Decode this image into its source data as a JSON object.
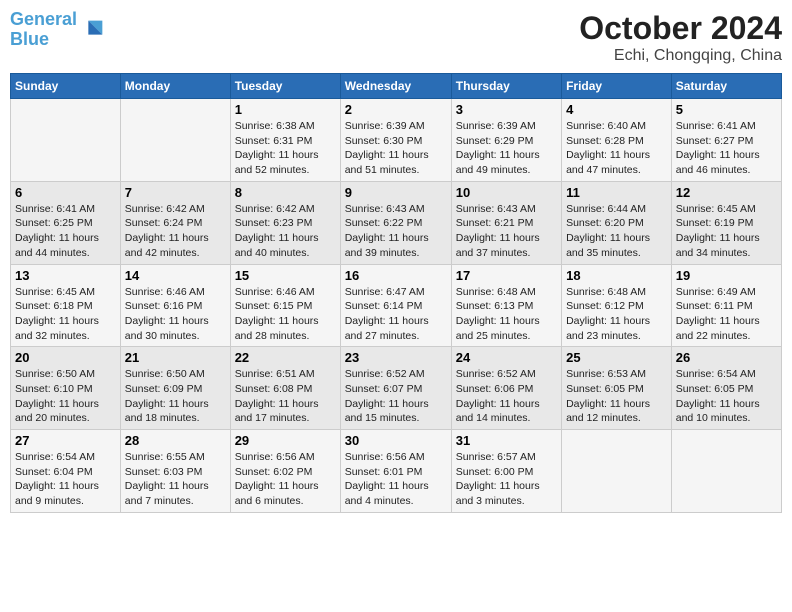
{
  "header": {
    "logo_line1": "General",
    "logo_line2": "Blue",
    "title": "October 2024",
    "subtitle": "Echi, Chongqing, China"
  },
  "days_of_week": [
    "Sunday",
    "Monday",
    "Tuesday",
    "Wednesday",
    "Thursday",
    "Friday",
    "Saturday"
  ],
  "weeks": [
    [
      {
        "day": "",
        "info": ""
      },
      {
        "day": "",
        "info": ""
      },
      {
        "day": "1",
        "info": "Sunrise: 6:38 AM\nSunset: 6:31 PM\nDaylight: 11 hours and 52 minutes."
      },
      {
        "day": "2",
        "info": "Sunrise: 6:39 AM\nSunset: 6:30 PM\nDaylight: 11 hours and 51 minutes."
      },
      {
        "day": "3",
        "info": "Sunrise: 6:39 AM\nSunset: 6:29 PM\nDaylight: 11 hours and 49 minutes."
      },
      {
        "day": "4",
        "info": "Sunrise: 6:40 AM\nSunset: 6:28 PM\nDaylight: 11 hours and 47 minutes."
      },
      {
        "day": "5",
        "info": "Sunrise: 6:41 AM\nSunset: 6:27 PM\nDaylight: 11 hours and 46 minutes."
      }
    ],
    [
      {
        "day": "6",
        "info": "Sunrise: 6:41 AM\nSunset: 6:25 PM\nDaylight: 11 hours and 44 minutes."
      },
      {
        "day": "7",
        "info": "Sunrise: 6:42 AM\nSunset: 6:24 PM\nDaylight: 11 hours and 42 minutes."
      },
      {
        "day": "8",
        "info": "Sunrise: 6:42 AM\nSunset: 6:23 PM\nDaylight: 11 hours and 40 minutes."
      },
      {
        "day": "9",
        "info": "Sunrise: 6:43 AM\nSunset: 6:22 PM\nDaylight: 11 hours and 39 minutes."
      },
      {
        "day": "10",
        "info": "Sunrise: 6:43 AM\nSunset: 6:21 PM\nDaylight: 11 hours and 37 minutes."
      },
      {
        "day": "11",
        "info": "Sunrise: 6:44 AM\nSunset: 6:20 PM\nDaylight: 11 hours and 35 minutes."
      },
      {
        "day": "12",
        "info": "Sunrise: 6:45 AM\nSunset: 6:19 PM\nDaylight: 11 hours and 34 minutes."
      }
    ],
    [
      {
        "day": "13",
        "info": "Sunrise: 6:45 AM\nSunset: 6:18 PM\nDaylight: 11 hours and 32 minutes."
      },
      {
        "day": "14",
        "info": "Sunrise: 6:46 AM\nSunset: 6:16 PM\nDaylight: 11 hours and 30 minutes."
      },
      {
        "day": "15",
        "info": "Sunrise: 6:46 AM\nSunset: 6:15 PM\nDaylight: 11 hours and 28 minutes."
      },
      {
        "day": "16",
        "info": "Sunrise: 6:47 AM\nSunset: 6:14 PM\nDaylight: 11 hours and 27 minutes."
      },
      {
        "day": "17",
        "info": "Sunrise: 6:48 AM\nSunset: 6:13 PM\nDaylight: 11 hours and 25 minutes."
      },
      {
        "day": "18",
        "info": "Sunrise: 6:48 AM\nSunset: 6:12 PM\nDaylight: 11 hours and 23 minutes."
      },
      {
        "day": "19",
        "info": "Sunrise: 6:49 AM\nSunset: 6:11 PM\nDaylight: 11 hours and 22 minutes."
      }
    ],
    [
      {
        "day": "20",
        "info": "Sunrise: 6:50 AM\nSunset: 6:10 PM\nDaylight: 11 hours and 20 minutes."
      },
      {
        "day": "21",
        "info": "Sunrise: 6:50 AM\nSunset: 6:09 PM\nDaylight: 11 hours and 18 minutes."
      },
      {
        "day": "22",
        "info": "Sunrise: 6:51 AM\nSunset: 6:08 PM\nDaylight: 11 hours and 17 minutes."
      },
      {
        "day": "23",
        "info": "Sunrise: 6:52 AM\nSunset: 6:07 PM\nDaylight: 11 hours and 15 minutes."
      },
      {
        "day": "24",
        "info": "Sunrise: 6:52 AM\nSunset: 6:06 PM\nDaylight: 11 hours and 14 minutes."
      },
      {
        "day": "25",
        "info": "Sunrise: 6:53 AM\nSunset: 6:05 PM\nDaylight: 11 hours and 12 minutes."
      },
      {
        "day": "26",
        "info": "Sunrise: 6:54 AM\nSunset: 6:05 PM\nDaylight: 11 hours and 10 minutes."
      }
    ],
    [
      {
        "day": "27",
        "info": "Sunrise: 6:54 AM\nSunset: 6:04 PM\nDaylight: 11 hours and 9 minutes."
      },
      {
        "day": "28",
        "info": "Sunrise: 6:55 AM\nSunset: 6:03 PM\nDaylight: 11 hours and 7 minutes."
      },
      {
        "day": "29",
        "info": "Sunrise: 6:56 AM\nSunset: 6:02 PM\nDaylight: 11 hours and 6 minutes."
      },
      {
        "day": "30",
        "info": "Sunrise: 6:56 AM\nSunset: 6:01 PM\nDaylight: 11 hours and 4 minutes."
      },
      {
        "day": "31",
        "info": "Sunrise: 6:57 AM\nSunset: 6:00 PM\nDaylight: 11 hours and 3 minutes."
      },
      {
        "day": "",
        "info": ""
      },
      {
        "day": "",
        "info": ""
      }
    ]
  ]
}
